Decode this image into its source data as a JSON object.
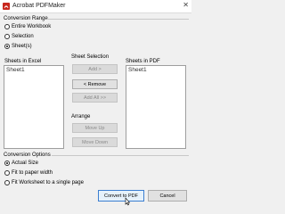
{
  "window": {
    "title": "Acrobat PDFMaker",
    "close_glyph": "✕"
  },
  "conversion_range": {
    "heading": "Conversion Range",
    "options": [
      {
        "label": "Entire Workbook",
        "checked": false
      },
      {
        "label": "Selection",
        "checked": false
      },
      {
        "label": "Sheet(s)",
        "checked": true
      }
    ]
  },
  "sheets_in_excel": {
    "heading": "Sheets in Excel",
    "items": [
      "Sheet1"
    ]
  },
  "sheet_selection": {
    "heading": "Sheet Selection",
    "add_label": "Add >",
    "remove_label": "< Remove",
    "add_all_label": "Add All >>"
  },
  "arrange": {
    "heading": "Arrange",
    "move_up_label": "Move Up",
    "move_down_label": "Move Down"
  },
  "sheets_in_pdf": {
    "heading": "Sheets in PDF",
    "items": [
      "Sheet1"
    ]
  },
  "conversion_options": {
    "heading": "Conversion Options",
    "options": [
      {
        "label": "Actual Size",
        "checked": true
      },
      {
        "label": "Fit to paper width",
        "checked": false
      },
      {
        "label": "Fit Worksheet to a single page",
        "checked": false
      }
    ]
  },
  "footer": {
    "convert_label": "Convert to PDF",
    "cancel_label": "Cancel"
  },
  "colors": {
    "brand": "#c8281e",
    "focus": "#3c7fd1"
  },
  "icons": [
    "acrobat-icon",
    "close-icon",
    "mouse-cursor-icon"
  ]
}
